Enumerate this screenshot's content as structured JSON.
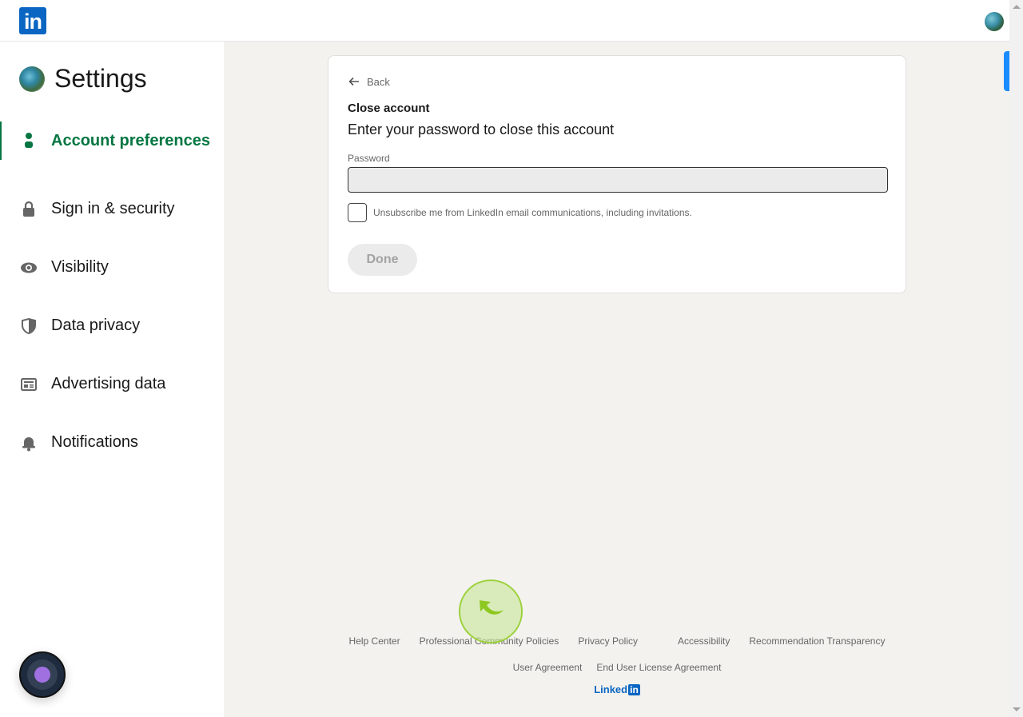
{
  "header": {
    "logo_text": "in",
    "avatar_alt": "profile-photo"
  },
  "sidebar": {
    "title": "Settings",
    "items": [
      {
        "label": "Account preferences",
        "icon": "person-icon",
        "active": true
      },
      {
        "label": "Sign in & security",
        "icon": "lock-icon",
        "active": false
      },
      {
        "label": "Visibility",
        "icon": "eye-icon",
        "active": false
      },
      {
        "label": "Data privacy",
        "icon": "shield-icon",
        "active": false
      },
      {
        "label": "Advertising data",
        "icon": "ad-card-icon",
        "active": false
      },
      {
        "label": "Notifications",
        "icon": "bell-icon",
        "active": false
      }
    ]
  },
  "card": {
    "back_label": "Back",
    "title": "Close account",
    "subtitle": "Enter your password to close this account",
    "password_label": "Password",
    "password_value": "",
    "checkbox_label": "Unsubscribe me from LinkedIn email communications, including invitations.",
    "checkbox_checked": false,
    "done_label": "Done"
  },
  "footer": {
    "row1": [
      "Help Center",
      "Professional Community Policies",
      "Privacy Policy",
      "Accessibility",
      "Recommendation Transparency"
    ],
    "row2": [
      "User Agreement",
      "End User License Agreement"
    ],
    "brand_text": "Linked",
    "brand_in": "in"
  },
  "colors": {
    "brand": "#0a66c2",
    "active_nav": "#057642",
    "background": "#f3f2ef"
  }
}
